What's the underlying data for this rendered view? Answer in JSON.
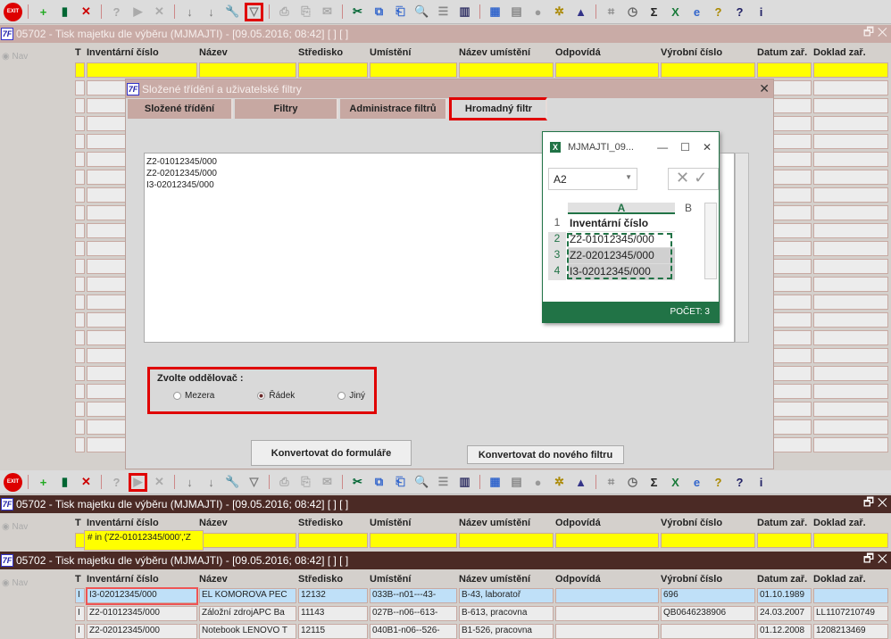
{
  "toolbar_top": {
    "icons": [
      {
        "name": "exit-icon",
        "g": "EXIT",
        "c": "#d00"
      },
      {
        "sep": 1
      },
      {
        "name": "add-record-icon",
        "g": "+",
        "c": "#2a2"
      },
      {
        "name": "edit-record-icon",
        "g": "▮",
        "c": "#063"
      },
      {
        "name": "delete-record-icon",
        "g": "✕",
        "c": "#c00"
      },
      {
        "sep": 1
      },
      {
        "name": "query-icon",
        "g": "?",
        "c": "#aaa"
      },
      {
        "name": "execute-query-icon",
        "g": "▶",
        "c": "#aaa"
      },
      {
        "name": "cancel-query-icon",
        "g": "✕",
        "c": "#aaa"
      },
      {
        "sep": 1
      },
      {
        "name": "sort-asc-icon",
        "g": "↓",
        "c": "#777"
      },
      {
        "name": "sort-desc-icon",
        "g": "↓",
        "c": "#777"
      },
      {
        "name": "wrench-icon",
        "g": "🔧",
        "c": "#555"
      },
      {
        "name": "filter-icon",
        "g": "▽",
        "c": "#777",
        "hl": 1
      },
      {
        "sep": 1
      },
      {
        "name": "print-icon",
        "g": "⎙",
        "c": "#aaa"
      },
      {
        "name": "print-setup-icon",
        "g": "⎘",
        "c": "#aaa"
      },
      {
        "name": "mail-icon",
        "g": "✉",
        "c": "#aaa"
      },
      {
        "sep": 1
      },
      {
        "name": "cut-icon",
        "g": "✂",
        "c": "#063"
      },
      {
        "name": "copy-icon",
        "g": "⧉",
        "c": "#36c"
      },
      {
        "name": "paste-icon",
        "g": "⎗",
        "c": "#36c"
      },
      {
        "name": "search-icon",
        "g": "🔍",
        "c": "#36c"
      },
      {
        "name": "list-icon",
        "g": "☰",
        "c": "#888"
      },
      {
        "name": "columns-icon",
        "g": "▥",
        "c": "#336"
      },
      {
        "sep": 1
      },
      {
        "name": "report-icon",
        "g": "▦",
        "c": "#36c"
      },
      {
        "name": "document-icon",
        "g": "▤",
        "c": "#888"
      },
      {
        "name": "globe-icon",
        "g": "●",
        "c": "#999"
      },
      {
        "name": "wheel-icon",
        "g": "✲",
        "c": "#a80"
      },
      {
        "name": "mountain-icon",
        "g": "▲",
        "c": "#338"
      },
      {
        "sep": 1
      },
      {
        "name": "chart-icon",
        "g": "⌗",
        "c": "#888"
      },
      {
        "name": "clock-icon",
        "g": "◷",
        "c": "#666"
      },
      {
        "name": "sum-icon",
        "g": "Σ",
        "c": "#222"
      },
      {
        "name": "excel-icon",
        "g": "X",
        "c": "#1a7a3a"
      },
      {
        "name": "ie-icon",
        "g": "e",
        "c": "#36c"
      },
      {
        "name": "help-icon",
        "g": "?",
        "c": "#a80"
      },
      {
        "name": "context-help-icon",
        "g": "?",
        "c": "#226"
      },
      {
        "name": "info-icon",
        "g": "i",
        "c": "#226"
      }
    ]
  },
  "toolbar_bottom": {
    "highlight": "execute-query-icon"
  },
  "window": {
    "title": "05702 - Tisk majetku dle výběru (MJMAJTI) - [09.05.2016; 08:42]  [ ]  [ ]",
    "restore": "🗗",
    "close": "✕",
    "nav": "Nav"
  },
  "columns": [
    "T",
    "Inventární číslo",
    "Název",
    "Středisko",
    "Umístění",
    "Název umístění",
    "Odpovídá",
    "Výrobní číslo",
    "Datum zař.",
    "Doklad zař."
  ],
  "filter_value": "# in ('Z2-01012345/000','Z",
  "rows": [
    [
      "I",
      "I3-02012345/000",
      "EL KOMOROVA PEC",
      "12132",
      "033B--n01---43-",
      "B-43, laboratoř",
      "",
      "696",
      "01.10.1989",
      ""
    ],
    [
      "I",
      "Z2-01012345/000",
      "Záložní zdrojAPC Ba",
      "11143",
      "027B--n06--613-",
      "B-613, pracovna",
      "",
      "QB0646238906",
      "24.03.2007",
      "LL1107210749"
    ],
    [
      "I",
      "Z2-02012345/000",
      "Notebook LENOVO T",
      "12115",
      "040B1-n06--526-",
      "B1-526, pracovna",
      "",
      "",
      "01.12.2008",
      "1208213469"
    ]
  ],
  "dialog": {
    "title": "Složené třídění a uživatelské filtry",
    "close": "✕",
    "tabs": [
      "Složené třídění",
      "Filtry",
      "Administrace filtrů",
      "Hromadný filtr"
    ],
    "text_lines": [
      "Z2-01012345/000",
      "Z2-02012345/000",
      "I3-02012345/000"
    ],
    "separator_label": "Zvolte oddělovač :",
    "options": [
      {
        "label": "Mezera",
        "checked": false
      },
      {
        "label": "Řádek",
        "checked": true
      },
      {
        "label": "Jiný",
        "checked": false
      }
    ],
    "btn_form": "Konvertovat do formuláře",
    "btn_new": "Konvertovat do nového filtru"
  },
  "excel": {
    "title": "MJMAJTI_09...",
    "min": "—",
    "max": "☐",
    "close": "✕",
    "namebox": "A2",
    "col_a": "A",
    "col_b": "B",
    "rows": [
      [
        "1",
        "Inventární číslo"
      ],
      [
        "2",
        "Z2-01012345/000"
      ],
      [
        "3",
        "Z2-02012345/000"
      ],
      [
        "4",
        "I3-02012345/000"
      ]
    ],
    "status": "POČET: 3",
    "accent": "#217346"
  }
}
